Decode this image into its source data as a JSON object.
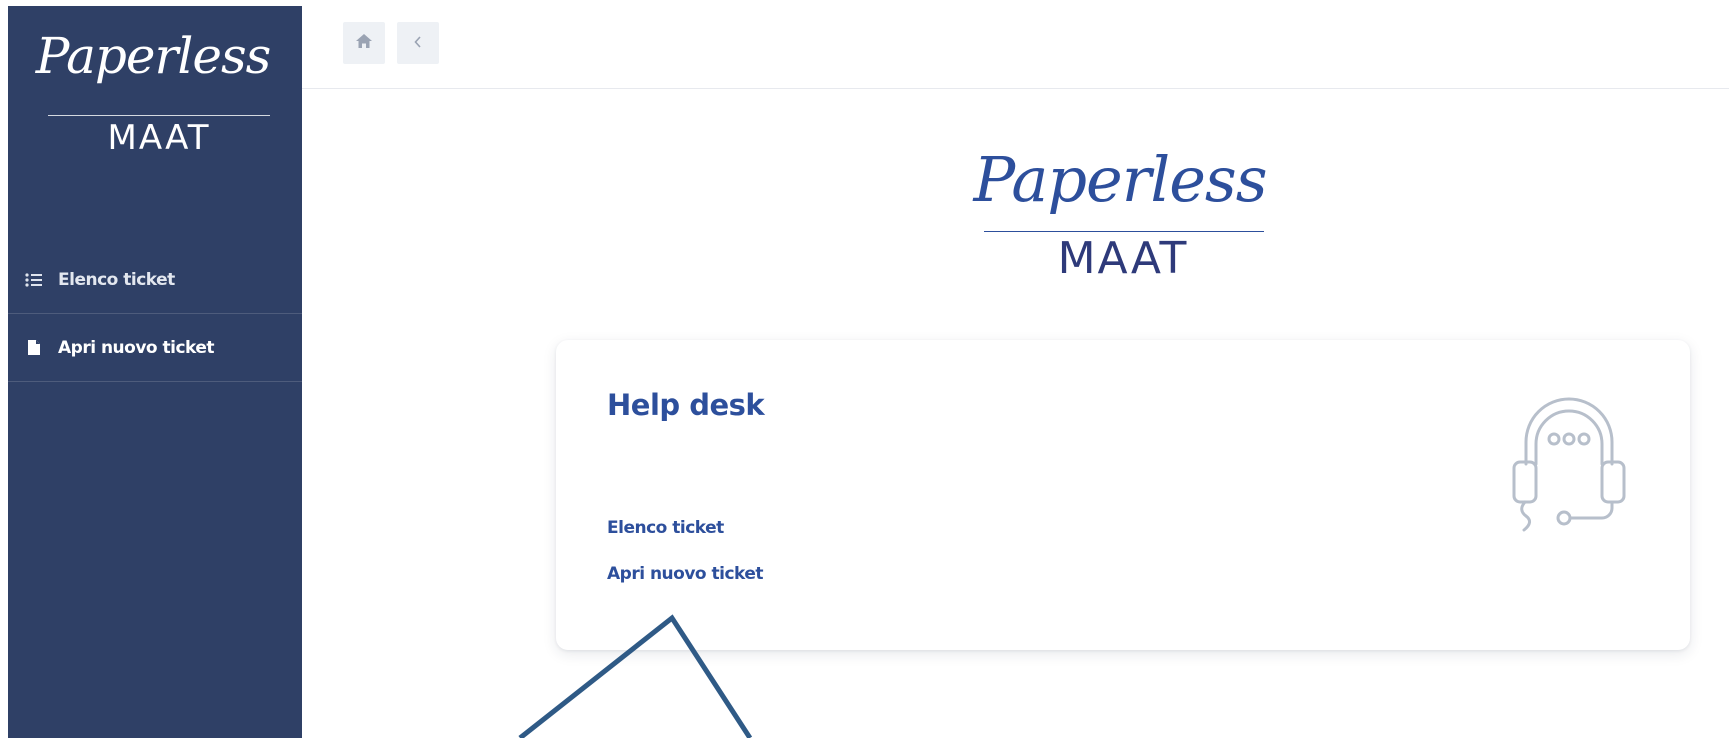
{
  "logo": {
    "script_text": "Paperless",
    "brand_text": "MAAT",
    "colors": {
      "sidebar_script": "#ffffff",
      "main_script": "#2d4f9c",
      "main_brand": "#2e3a7a"
    }
  },
  "sidebar": {
    "background": "#2f4066",
    "items": [
      {
        "label": "Elenco ticket",
        "icon": "list-icon"
      },
      {
        "label": "Apri nuovo ticket",
        "icon": "file-icon"
      }
    ]
  },
  "topbar": {
    "home_icon": "home-icon",
    "back_icon": "chevron-left-icon"
  },
  "card": {
    "title": "Help desk",
    "links": [
      {
        "label": "Elenco ticket"
      },
      {
        "label": "Apri nuovo ticket"
      }
    ],
    "icon": "headset-support-icon",
    "accent_color": "#2d4f9c"
  },
  "annotation": {
    "icon": "arrow-annotation-icon",
    "color": "#2f5a86"
  }
}
